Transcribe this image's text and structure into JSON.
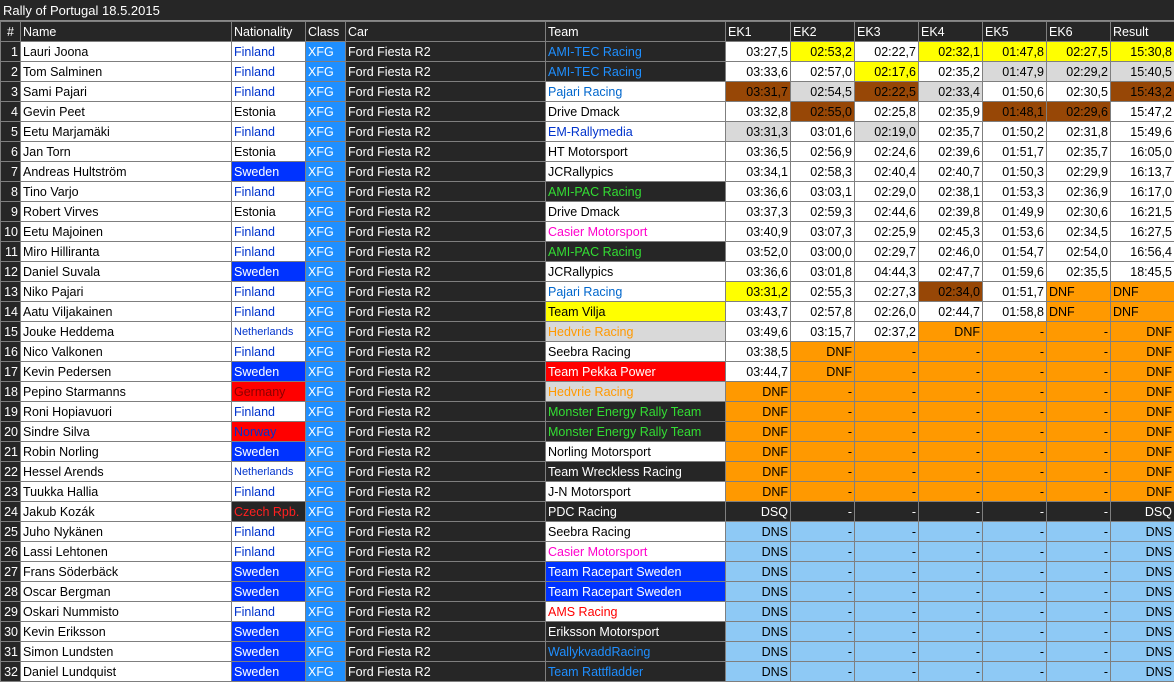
{
  "title": "Rally of Portugal 18.5.2015",
  "columns": [
    "#",
    "Name",
    "Nationality",
    "Class",
    "Car",
    "Team",
    "EK1",
    "EK2",
    "EK3",
    "EK4",
    "EK5",
    "EK6",
    "Result"
  ],
  "colors": {
    "dark": "#262626",
    "white": "#ffffff",
    "yellow": "#ffff00",
    "silver": "#d9d9d9",
    "bronze": "#974706",
    "orange": "#ff9900",
    "lightblue": "#8ec9f5",
    "blue": "#0033ff",
    "classblue": "#1f8fff",
    "red": "#ff0000"
  },
  "rows": [
    {
      "n": "1",
      "name": "Lauri Joona",
      "nat": "Finland",
      "nat_style": "fin",
      "cls": "XFG",
      "car": "Ford Fiesta R2",
      "team": "AMI-TEC Racing",
      "team_style": "amitec",
      "t": [
        "03:27,5",
        "02:53,2",
        "02:22,7",
        "02:32,1",
        "01:47,8",
        "02:27,5",
        "15:30,8"
      ],
      "ts": [
        "w",
        "y",
        "w",
        "y",
        "y",
        "y",
        "y"
      ]
    },
    {
      "n": "2",
      "name": "Tom Salminen",
      "nat": "Finland",
      "nat_style": "fin",
      "cls": "XFG",
      "car": "Ford Fiesta R2",
      "team": "AMI-TEC Racing",
      "team_style": "amitec",
      "t": [
        "03:33,6",
        "02:57,0",
        "02:17,6",
        "02:35,2",
        "01:47,9",
        "02:29,2",
        "15:40,5"
      ],
      "ts": [
        "w",
        "w",
        "y",
        "w",
        "s",
        "s",
        "s"
      ]
    },
    {
      "n": "3",
      "name": "Sami Pajari",
      "nat": "Finland",
      "nat_style": "fin",
      "cls": "XFG",
      "car": "Ford Fiesta R2",
      "team": "Pajari Racing",
      "team_style": "pajari",
      "t": [
        "03:31,7",
        "02:54,5",
        "02:22,5",
        "02:33,4",
        "01:50,6",
        "02:30,5",
        "15:43,2"
      ],
      "ts": [
        "b",
        "s",
        "b",
        "s",
        "w",
        "w",
        "b"
      ]
    },
    {
      "n": "4",
      "name": "Gevin Peet",
      "nat": "Estonia",
      "nat_style": "est",
      "cls": "XFG",
      "car": "Ford Fiesta R2",
      "team": "Drive Dmack",
      "team_style": "plain",
      "t": [
        "03:32,8",
        "02:55,0",
        "02:25,8",
        "02:35,9",
        "01:48,1",
        "02:29,6",
        "15:47,2"
      ],
      "ts": [
        "w",
        "b",
        "w",
        "w",
        "b",
        "b",
        "w"
      ]
    },
    {
      "n": "5",
      "name": "Eetu Marjamäki",
      "nat": "Finland",
      "nat_style": "fin",
      "cls": "XFG",
      "car": "Ford Fiesta R2",
      "team": "EM-Rallymedia",
      "team_style": "em",
      "t": [
        "03:31,3",
        "03:01,6",
        "02:19,0",
        "02:35,7",
        "01:50,2",
        "02:31,8",
        "15:49,6"
      ],
      "ts": [
        "s",
        "w",
        "s",
        "w",
        "w",
        "w",
        "w"
      ]
    },
    {
      "n": "6",
      "name": "Jan Torn",
      "nat": "Estonia",
      "nat_style": "est",
      "cls": "XFG",
      "car": "Ford Fiesta R2",
      "team": "HT Motorsport",
      "team_style": "plain",
      "t": [
        "03:36,5",
        "02:56,9",
        "02:24,6",
        "02:39,6",
        "01:51,7",
        "02:35,7",
        "16:05,0"
      ],
      "ts": [
        "w",
        "w",
        "w",
        "w",
        "w",
        "w",
        "w"
      ]
    },
    {
      "n": "7",
      "name": "Andreas Hultström",
      "nat": "Sweden",
      "nat_style": "swe",
      "cls": "XFG",
      "car": "Ford Fiesta R2",
      "team": "JCRallypics",
      "team_style": "plain",
      "t": [
        "03:34,1",
        "02:58,3",
        "02:40,4",
        "02:40,7",
        "01:50,3",
        "02:29,9",
        "16:13,7"
      ],
      "ts": [
        "w",
        "w",
        "w",
        "w",
        "w",
        "w",
        "w"
      ]
    },
    {
      "n": "8",
      "name": "Tino Varjo",
      "nat": "Finland",
      "nat_style": "fin",
      "cls": "XFG",
      "car": "Ford Fiesta R2",
      "team": "AMI-PAC Racing",
      "team_style": "amipac",
      "t": [
        "03:36,6",
        "03:03,1",
        "02:29,0",
        "02:38,1",
        "01:53,3",
        "02:36,9",
        "16:17,0"
      ],
      "ts": [
        "w",
        "w",
        "w",
        "w",
        "w",
        "w",
        "w"
      ]
    },
    {
      "n": "9",
      "name": "Robert Virves",
      "nat": "Estonia",
      "nat_style": "est",
      "cls": "XFG",
      "car": "Ford Fiesta R2",
      "team": "Drive Dmack",
      "team_style": "plain",
      "t": [
        "03:37,3",
        "02:59,3",
        "02:44,6",
        "02:39,8",
        "01:49,9",
        "02:30,6",
        "16:21,5"
      ],
      "ts": [
        "w",
        "w",
        "w",
        "w",
        "w",
        "w",
        "w"
      ]
    },
    {
      "n": "10",
      "name": "Eetu Majoinen",
      "nat": "Finland",
      "nat_style": "fin",
      "cls": "XFG",
      "car": "Ford Fiesta R2",
      "team": "Casier Motorsport",
      "team_style": "casier",
      "t": [
        "03:40,9",
        "03:07,3",
        "02:25,9",
        "02:45,3",
        "01:53,6",
        "02:34,5",
        "16:27,5"
      ],
      "ts": [
        "w",
        "w",
        "w",
        "w",
        "w",
        "w",
        "w"
      ]
    },
    {
      "n": "11",
      "name": "Miro Hilliranta",
      "nat": "Finland",
      "nat_style": "fin",
      "cls": "XFG",
      "car": "Ford Fiesta R2",
      "team": "AMI-PAC Racing",
      "team_style": "amipac",
      "t": [
        "03:52,0",
        "03:00,0",
        "02:29,7",
        "02:46,0",
        "01:54,7",
        "02:54,0",
        "16:56,4"
      ],
      "ts": [
        "w",
        "w",
        "w",
        "w",
        "w",
        "w",
        "w"
      ]
    },
    {
      "n": "12",
      "name": "Daniel Suvala",
      "nat": "Sweden",
      "nat_style": "swe",
      "cls": "XFG",
      "car": "Ford Fiesta R2",
      "team": "JCRallypics",
      "team_style": "plain",
      "t": [
        "03:36,6",
        "03:01,8",
        "04:44,3",
        "02:47,7",
        "01:59,6",
        "02:35,5",
        "18:45,5"
      ],
      "ts": [
        "w",
        "w",
        "w",
        "w",
        "w",
        "w",
        "w"
      ]
    },
    {
      "n": "13",
      "name": "Niko Pajari",
      "nat": "Finland",
      "nat_style": "fin",
      "cls": "XFG",
      "car": "Ford Fiesta R2",
      "team": "Pajari Racing",
      "team_style": "pajari",
      "t": [
        "03:31,2",
        "02:55,3",
        "02:27,3",
        "02:34,0",
        "01:51,7",
        "DNF",
        "DNF"
      ],
      "ts": [
        "y",
        "w",
        "w",
        "b",
        "w",
        "oL",
        "oL"
      ]
    },
    {
      "n": "14",
      "name": "Aatu Viljakainen",
      "nat": "Finland",
      "nat_style": "fin",
      "cls": "XFG",
      "car": "Ford Fiesta R2",
      "team": "Team Vilja",
      "team_style": "vilja",
      "t": [
        "03:43,7",
        "02:57,8",
        "02:26,0",
        "02:44,7",
        "01:58,8",
        "DNF",
        "DNF"
      ],
      "ts": [
        "w",
        "w",
        "w",
        "w",
        "w",
        "oL",
        "oL"
      ]
    },
    {
      "n": "15",
      "name": "Jouke Heddema",
      "nat": "Netherlands",
      "nat_style": "ned",
      "cls": "XFG",
      "car": "Ford Fiesta R2",
      "team": "Hedvrie Racing",
      "team_style": "hedvrie",
      "t": [
        "03:49,6",
        "03:15,7",
        "02:37,2",
        "DNF",
        "-",
        "-",
        "DNF"
      ],
      "ts": [
        "w",
        "w",
        "w",
        "o",
        "o",
        "o",
        "o"
      ]
    },
    {
      "n": "16",
      "name": "Nico Valkonen",
      "nat": "Finland",
      "nat_style": "fin",
      "cls": "XFG",
      "car": "Ford Fiesta R2",
      "team": "Seebra Racing",
      "team_style": "plain",
      "t": [
        "03:38,5",
        "DNF",
        "-",
        "-",
        "-",
        "-",
        "DNF"
      ],
      "ts": [
        "w",
        "o",
        "o",
        "o",
        "o",
        "o",
        "o"
      ]
    },
    {
      "n": "17",
      "name": "Kevin Pedersen",
      "nat": "Sweden",
      "nat_style": "swe",
      "cls": "XFG",
      "car": "Ford Fiesta R2",
      "team": "Team Pekka Power",
      "team_style": "pekka",
      "t": [
        "03:44,7",
        "DNF",
        "-",
        "-",
        "-",
        "-",
        "DNF"
      ],
      "ts": [
        "w",
        "o",
        "o",
        "o",
        "o",
        "o",
        "o"
      ]
    },
    {
      "n": "18",
      "name": "Pepino Starmanns",
      "nat": "Germany",
      "nat_style": "ger",
      "cls": "XFG",
      "car": "Ford Fiesta R2",
      "team": "Hedvrie Racing",
      "team_style": "hedvrie",
      "t": [
        "DNF",
        "-",
        "-",
        "-",
        "-",
        "-",
        "DNF"
      ],
      "ts": [
        "o",
        "o",
        "o",
        "o",
        "o",
        "o",
        "o"
      ]
    },
    {
      "n": "19",
      "name": "Roni Hopiavuori",
      "nat": "Finland",
      "nat_style": "fin",
      "cls": "XFG",
      "car": "Ford Fiesta R2",
      "team": "Monster Energy Rally Team",
      "team_style": "monster",
      "t": [
        "DNF",
        "-",
        "-",
        "-",
        "-",
        "-",
        "DNF"
      ],
      "ts": [
        "o",
        "o",
        "o",
        "o",
        "o",
        "o",
        "o"
      ]
    },
    {
      "n": "20",
      "name": "Sindre Silva",
      "nat": "Norway",
      "nat_style": "nor",
      "cls": "XFG",
      "car": "Ford Fiesta R2",
      "team": "Monster Energy Rally Team",
      "team_style": "monster",
      "t": [
        "DNF",
        "-",
        "-",
        "-",
        "-",
        "-",
        "DNF"
      ],
      "ts": [
        "o",
        "o",
        "o",
        "o",
        "o",
        "o",
        "o"
      ]
    },
    {
      "n": "21",
      "name": "Robin Norling",
      "nat": "Sweden",
      "nat_style": "swe",
      "cls": "XFG",
      "car": "Ford Fiesta R2",
      "team": "Norling Motorsport",
      "team_style": "plain",
      "t": [
        "DNF",
        "-",
        "-",
        "-",
        "-",
        "-",
        "DNF"
      ],
      "ts": [
        "o",
        "o",
        "o",
        "o",
        "o",
        "o",
        "o"
      ]
    },
    {
      "n": "22",
      "name": "Hessel Arends",
      "nat": "Netherlands",
      "nat_style": "ned",
      "cls": "XFG",
      "car": "Ford Fiesta R2",
      "team": "Team Wreckless Racing",
      "team_style": "darkwhite",
      "t": [
        "DNF",
        "-",
        "-",
        "-",
        "-",
        "-",
        "DNF"
      ],
      "ts": [
        "o",
        "o",
        "o",
        "o",
        "o",
        "o",
        "o"
      ]
    },
    {
      "n": "23",
      "name": "Tuukka Hallia",
      "nat": "Finland",
      "nat_style": "fin",
      "cls": "XFG",
      "car": "Ford Fiesta R2",
      "team": "J-N Motorsport",
      "team_style": "plain",
      "t": [
        "DNF",
        "-",
        "-",
        "-",
        "-",
        "-",
        "DNF"
      ],
      "ts": [
        "o",
        "o",
        "o",
        "o",
        "o",
        "o",
        "o"
      ]
    },
    {
      "n": "24",
      "name": "Jakub Kozák",
      "nat": "Czech Rpb.",
      "nat_style": "cze",
      "cls": "XFG",
      "car": "Ford Fiesta R2",
      "team": "PDC Racing",
      "team_style": "darkwhite",
      "t": [
        "DSQ",
        "-",
        "-",
        "-",
        "-",
        "-",
        "DSQ"
      ],
      "ts": [
        "d",
        "d",
        "d",
        "d",
        "d",
        "d",
        "d"
      ]
    },
    {
      "n": "25",
      "name": "Juho Nykänen",
      "nat": "Finland",
      "nat_style": "fin",
      "cls": "XFG",
      "car": "Ford Fiesta R2",
      "team": "Seebra Racing",
      "team_style": "plain",
      "t": [
        "DNS",
        "-",
        "-",
        "-",
        "-",
        "-",
        "DNS"
      ],
      "ts": [
        "l",
        "l",
        "l",
        "l",
        "l",
        "l",
        "l"
      ]
    },
    {
      "n": "26",
      "name": "Lassi Lehtonen",
      "nat": "Finland",
      "nat_style": "fin",
      "cls": "XFG",
      "car": "Ford Fiesta R2",
      "team": "Casier Motorsport",
      "team_style": "casier",
      "t": [
        "DNS",
        "-",
        "-",
        "-",
        "-",
        "-",
        "DNS"
      ],
      "ts": [
        "l",
        "l",
        "l",
        "l",
        "l",
        "l",
        "l"
      ]
    },
    {
      "n": "27",
      "name": "Frans Söderbäck",
      "nat": "Sweden",
      "nat_style": "swe",
      "cls": "XFG",
      "car": "Ford Fiesta R2",
      "team": "Team Racepart Sweden",
      "team_style": "racepart",
      "t": [
        "DNS",
        "-",
        "-",
        "-",
        "-",
        "-",
        "DNS"
      ],
      "ts": [
        "l",
        "l",
        "l",
        "l",
        "l",
        "l",
        "l"
      ]
    },
    {
      "n": "28",
      "name": "Oscar Bergman",
      "nat": "Sweden",
      "nat_style": "swe",
      "cls": "XFG",
      "car": "Ford Fiesta R2",
      "team": "Team Racepart Sweden",
      "team_style": "racepart",
      "t": [
        "DNS",
        "-",
        "-",
        "-",
        "-",
        "-",
        "DNS"
      ],
      "ts": [
        "l",
        "l",
        "l",
        "l",
        "l",
        "l",
        "l"
      ]
    },
    {
      "n": "29",
      "name": "Oskari Nummisto",
      "nat": "Finland",
      "nat_style": "fin",
      "cls": "XFG",
      "car": "Ford Fiesta R2",
      "team": "AMS Racing",
      "team_style": "ams",
      "t": [
        "DNS",
        "-",
        "-",
        "-",
        "-",
        "-",
        "DNS"
      ],
      "ts": [
        "l",
        "l",
        "l",
        "l",
        "l",
        "l",
        "l"
      ]
    },
    {
      "n": "30",
      "name": "Kevin Eriksson",
      "nat": "Sweden",
      "nat_style": "swe",
      "cls": "XFG",
      "car": "Ford Fiesta R2",
      "team": "Eriksson Motorsport",
      "team_style": "darkwhite",
      "t": [
        "DNS",
        "-",
        "-",
        "-",
        "-",
        "-",
        "DNS"
      ],
      "ts": [
        "l",
        "l",
        "l",
        "l",
        "l",
        "l",
        "l"
      ]
    },
    {
      "n": "31",
      "name": "Simon Lundsten",
      "nat": "Sweden",
      "nat_style": "swe",
      "cls": "XFG",
      "car": "Ford Fiesta R2",
      "team": "WallykvaddRacing",
      "team_style": "wally",
      "t": [
        "DNS",
        "-",
        "-",
        "-",
        "-",
        "-",
        "DNS"
      ],
      "ts": [
        "l",
        "l",
        "l",
        "l",
        "l",
        "l",
        "l"
      ]
    },
    {
      "n": "32",
      "name": "Daniel Lundquist",
      "nat": "Sweden",
      "nat_style": "swe",
      "cls": "XFG",
      "car": "Ford Fiesta R2",
      "team": "Team Rattfladder",
      "team_style": "wally",
      "t": [
        "DNS",
        "-",
        "-",
        "-",
        "-",
        "-",
        "DNS"
      ],
      "ts": [
        "l",
        "l",
        "l",
        "l",
        "l",
        "l",
        "l"
      ]
    }
  ]
}
